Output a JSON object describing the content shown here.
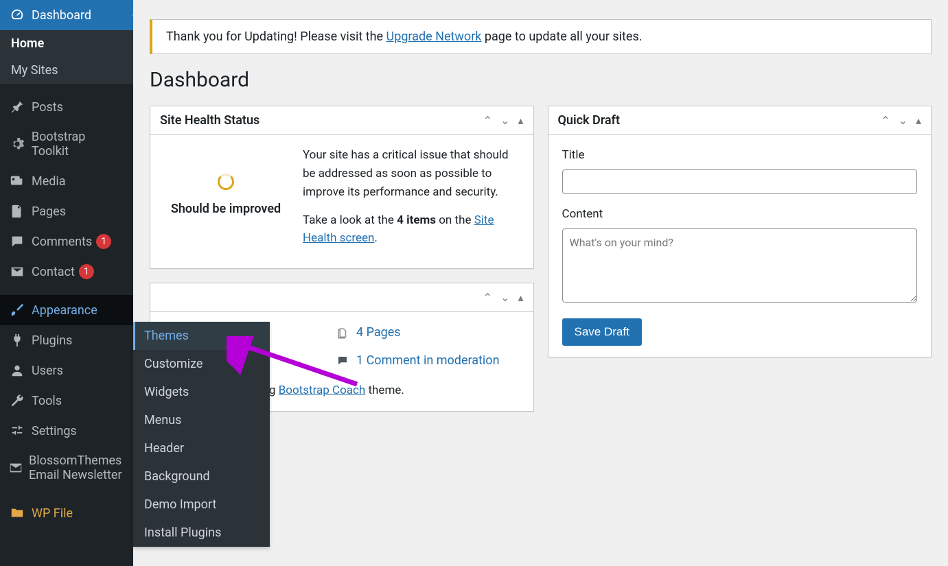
{
  "sidebar": {
    "dashboard": "Dashboard",
    "home": "Home",
    "my_sites": "My Sites",
    "posts": "Posts",
    "bootstrap_toolkit": "Bootstrap Toolkit",
    "media": "Media",
    "pages": "Pages",
    "comments": "Comments",
    "comments_badge": "1",
    "contact": "Contact",
    "contact_badge": "1",
    "appearance": "Appearance",
    "plugins": "Plugins",
    "users": "Users",
    "tools": "Tools",
    "settings": "Settings",
    "blossom": "BlossomThemes Email Newsletter",
    "wpfile": "WP File"
  },
  "flyout": {
    "themes": "Themes",
    "customize": "Customize",
    "widgets": "Widgets",
    "menus": "Menus",
    "header": "Header",
    "background": "Background",
    "demo_import": "Demo Import",
    "install_plugins": "Install Plugins"
  },
  "notice": {
    "pre": "Thank you for Updating! Please visit the ",
    "link": "Upgrade Network",
    "post": " page to update all your sites."
  },
  "page_title": "Dashboard",
  "health": {
    "title": "Site Health Status",
    "status": "Should be improved",
    "text1": "Your site has a critical issue that should be addressed as soon as possible to improve its performance and security.",
    "text2_pre": "Take a look at the ",
    "items_count": "4 items",
    "text2_mid": " on the ",
    "link": "Site Health screen",
    "dot": "."
  },
  "quickdraft": {
    "title": "Quick Draft",
    "title_label": "Title",
    "content_label": "Content",
    "placeholder": "What's on your mind?",
    "save": "Save Draft"
  },
  "glance": {
    "pages": "4 Pages",
    "comments": "1 Comment in moderation",
    "running_pre": "ning ",
    "theme_link": "Bootstrap Coach",
    "running_post": " theme."
  }
}
